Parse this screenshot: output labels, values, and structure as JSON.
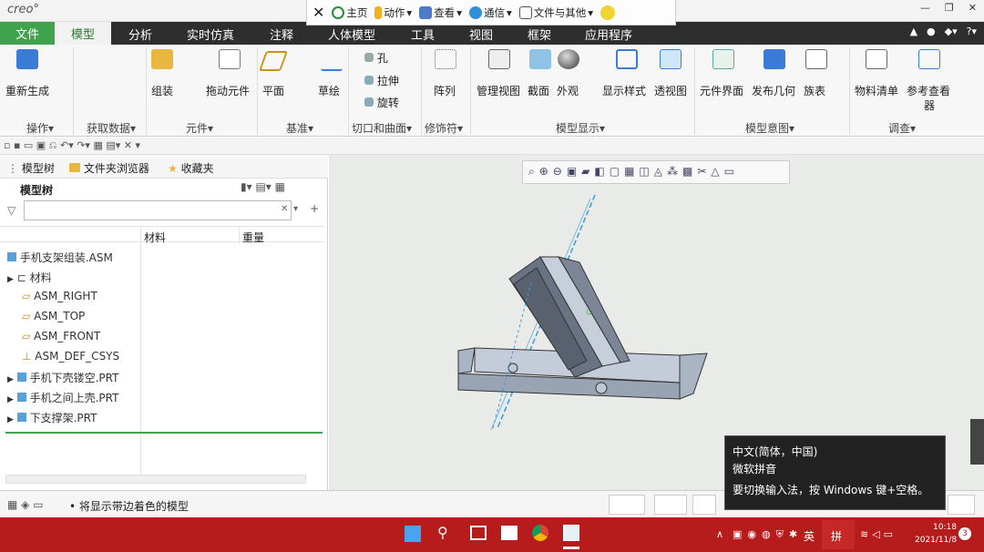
{
  "app": {
    "logo": "creo°"
  },
  "quick_access": {
    "home": "主页",
    "action": "动作",
    "view": "查看",
    "comm": "通信",
    "files_other": "文件与其他"
  },
  "menu": {
    "file": "文件",
    "model": "模型",
    "analysis": "分析",
    "simulation": "实时仿真",
    "annotate": "注释",
    "human": "人体模型",
    "tools": "工具",
    "view": "视图",
    "frame": "框架",
    "apps": "应用程序"
  },
  "ribbon": {
    "regenerate": "重新生成",
    "assemble": "组装",
    "drag": "拖动元件",
    "plane": "平面",
    "sketch": "草绘",
    "hole": "孔",
    "extrude": "拉伸",
    "revolve": "旋转",
    "pattern": "阵列",
    "manage_views": "管理视图",
    "section": "截面",
    "appearance": "外观",
    "display_style": "显示样式",
    "perspective": "透视图",
    "comp_interface": "元件界面",
    "publish_geom": "发布几何",
    "family_table": "族表",
    "bom": "物料清单",
    "ref_viewer_1": "参考查看",
    "ref_viewer_2": "器",
    "groups": {
      "operations": "操作▾",
      "get_data": "获取数据▾",
      "component": "元件▾",
      "datum": "基准▾",
      "cut_surface": "切口和曲面▾",
      "modifiers": "修饰符▾",
      "model_display": "模型显示▾",
      "model_intent": "模型意图▾",
      "investigate": "调查▾"
    }
  },
  "panel": {
    "tabs": {
      "model_tree": "模型树",
      "folder_browser": "文件夹浏览器",
      "favorites": "收藏夹"
    },
    "title": "模型树",
    "columns": {
      "material": "材料",
      "weight": "重量"
    },
    "tree": [
      {
        "label": "手机支架组装.ASM"
      },
      {
        "label": "材料"
      },
      {
        "label": "ASM_RIGHT"
      },
      {
        "label": "ASM_TOP"
      },
      {
        "label": "ASM_FRONT"
      },
      {
        "label": "ASM_DEF_CSYS"
      },
      {
        "label": "手机下壳镂空.PRT"
      },
      {
        "label": "手机之间上壳.PRT"
      },
      {
        "label": "下支撑架.PRT"
      }
    ]
  },
  "status": {
    "message": "• 将显示带边着色的模型"
  },
  "ime_popup": {
    "line1": "中文(简体，中国)",
    "line2": "微软拼音",
    "line3": "要切换输入法，按 Windows 键+空格。"
  },
  "tray": {
    "lang": "英",
    "ime": "拼",
    "time": "10:18",
    "date": "2021/11/8",
    "notif": "3"
  },
  "colors": {
    "accent": "#3fa34d",
    "taskbar": "#b71c1c",
    "menubar": "#2e2e2e"
  }
}
